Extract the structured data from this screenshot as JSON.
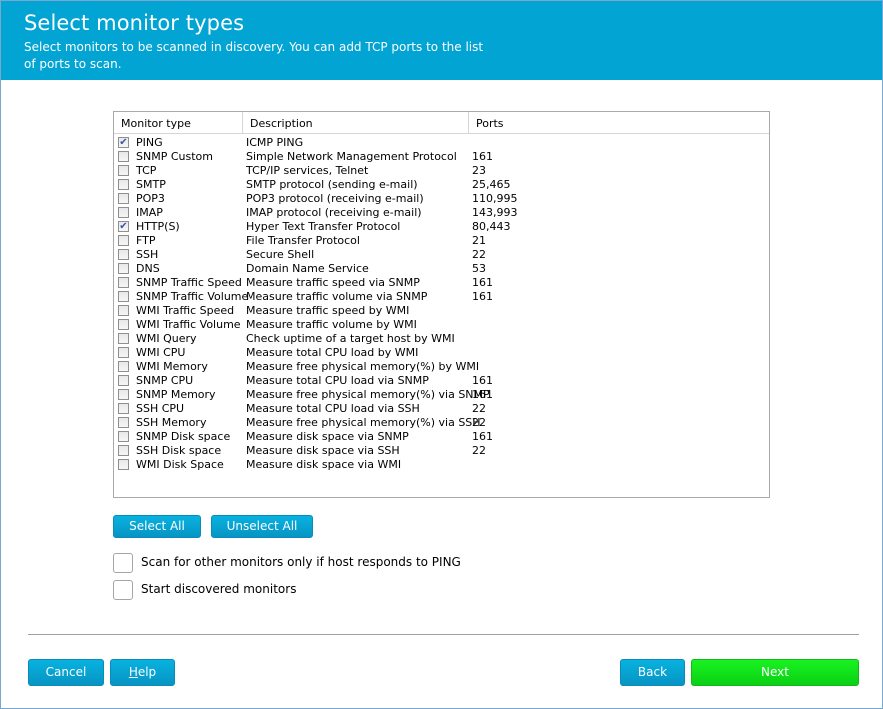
{
  "header": {
    "title": "Select monitor types",
    "subtitle": "Select monitors to be scanned in discovery. You can add TCP ports to the list of ports to scan."
  },
  "table": {
    "columns": [
      "Monitor type",
      "Description",
      "Ports"
    ],
    "rows": [
      {
        "type": "PING",
        "description": "ICMP PING",
        "ports": "",
        "checked": true
      },
      {
        "type": "SNMP Custom",
        "description": "Simple Network Management Protocol",
        "ports": "161",
        "checked": false
      },
      {
        "type": "TCP",
        "description": "TCP/IP services, Telnet",
        "ports": "23",
        "checked": false
      },
      {
        "type": "SMTP",
        "description": "SMTP protocol (sending e-mail)",
        "ports": "25,465",
        "checked": false
      },
      {
        "type": "POP3",
        "description": "POP3 protocol (receiving e-mail)",
        "ports": "110,995",
        "checked": false
      },
      {
        "type": "IMAP",
        "description": "IMAP protocol (receiving e-mail)",
        "ports": "143,993",
        "checked": false
      },
      {
        "type": "HTTP(S)",
        "description": "Hyper Text Transfer Protocol",
        "ports": "80,443",
        "checked": true
      },
      {
        "type": "FTP",
        "description": "File Transfer Protocol",
        "ports": "21",
        "checked": false
      },
      {
        "type": "SSH",
        "description": "Secure Shell",
        "ports": "22",
        "checked": false
      },
      {
        "type": "DNS",
        "description": "Domain Name Service",
        "ports": "53",
        "checked": false
      },
      {
        "type": "SNMP Traffic Speed",
        "description": "Measure traffic speed via SNMP",
        "ports": "161",
        "checked": false
      },
      {
        "type": "SNMP Traffic Volume",
        "description": "Measure traffic volume via SNMP",
        "ports": "161",
        "checked": false
      },
      {
        "type": "WMI Traffic Speed",
        "description": "Measure traffic speed by WMI",
        "ports": "",
        "checked": false
      },
      {
        "type": "WMI Traffic Volume",
        "description": "Measure traffic volume by WMI",
        "ports": "",
        "checked": false
      },
      {
        "type": "WMI Query",
        "description": "Check uptime of a target host by WMI",
        "ports": "",
        "checked": false
      },
      {
        "type": "WMI CPU",
        "description": "Measure total CPU load by WMI",
        "ports": "",
        "checked": false
      },
      {
        "type": "WMI Memory",
        "description": "Measure free physical memory(%) by WMI",
        "ports": "",
        "checked": false
      },
      {
        "type": "SNMP CPU",
        "description": "Measure total CPU load via SNMP",
        "ports": "161",
        "checked": false
      },
      {
        "type": "SNMP Memory",
        "description": "Measure free physical memory(%) via SNMP",
        "ports": "161",
        "checked": false
      },
      {
        "type": "SSH CPU",
        "description": "Measure total CPU load via SSH",
        "ports": "22",
        "checked": false
      },
      {
        "type": "SSH Memory",
        "description": "Measure free physical memory(%) via SSH",
        "ports": "22",
        "checked": false
      },
      {
        "type": "SNMP Disk space",
        "description": "Measure disk space via SNMP",
        "ports": "161",
        "checked": false
      },
      {
        "type": "SSH Disk space",
        "description": "Measure disk space via SSH",
        "ports": "22",
        "checked": false
      },
      {
        "type": "WMI Disk Space",
        "description": "Measure disk space via WMI",
        "ports": "",
        "checked": false
      }
    ]
  },
  "buttons": {
    "select_all": "Select All",
    "unselect_all": "Unselect All",
    "cancel": "Cancel",
    "help_mnemonic": "H",
    "help_rest": "elp",
    "back": "Back",
    "next": "Next"
  },
  "options": {
    "scan_ping_only": {
      "label": "Scan for other monitors only if host responds to PING",
      "checked": false
    },
    "start_discovered": {
      "label": "Start discovered monitors",
      "checked": false
    }
  },
  "colors": {
    "header_bg": "#02a4d3",
    "button_blue": "#0794c3",
    "button_green": "#0bd014"
  }
}
